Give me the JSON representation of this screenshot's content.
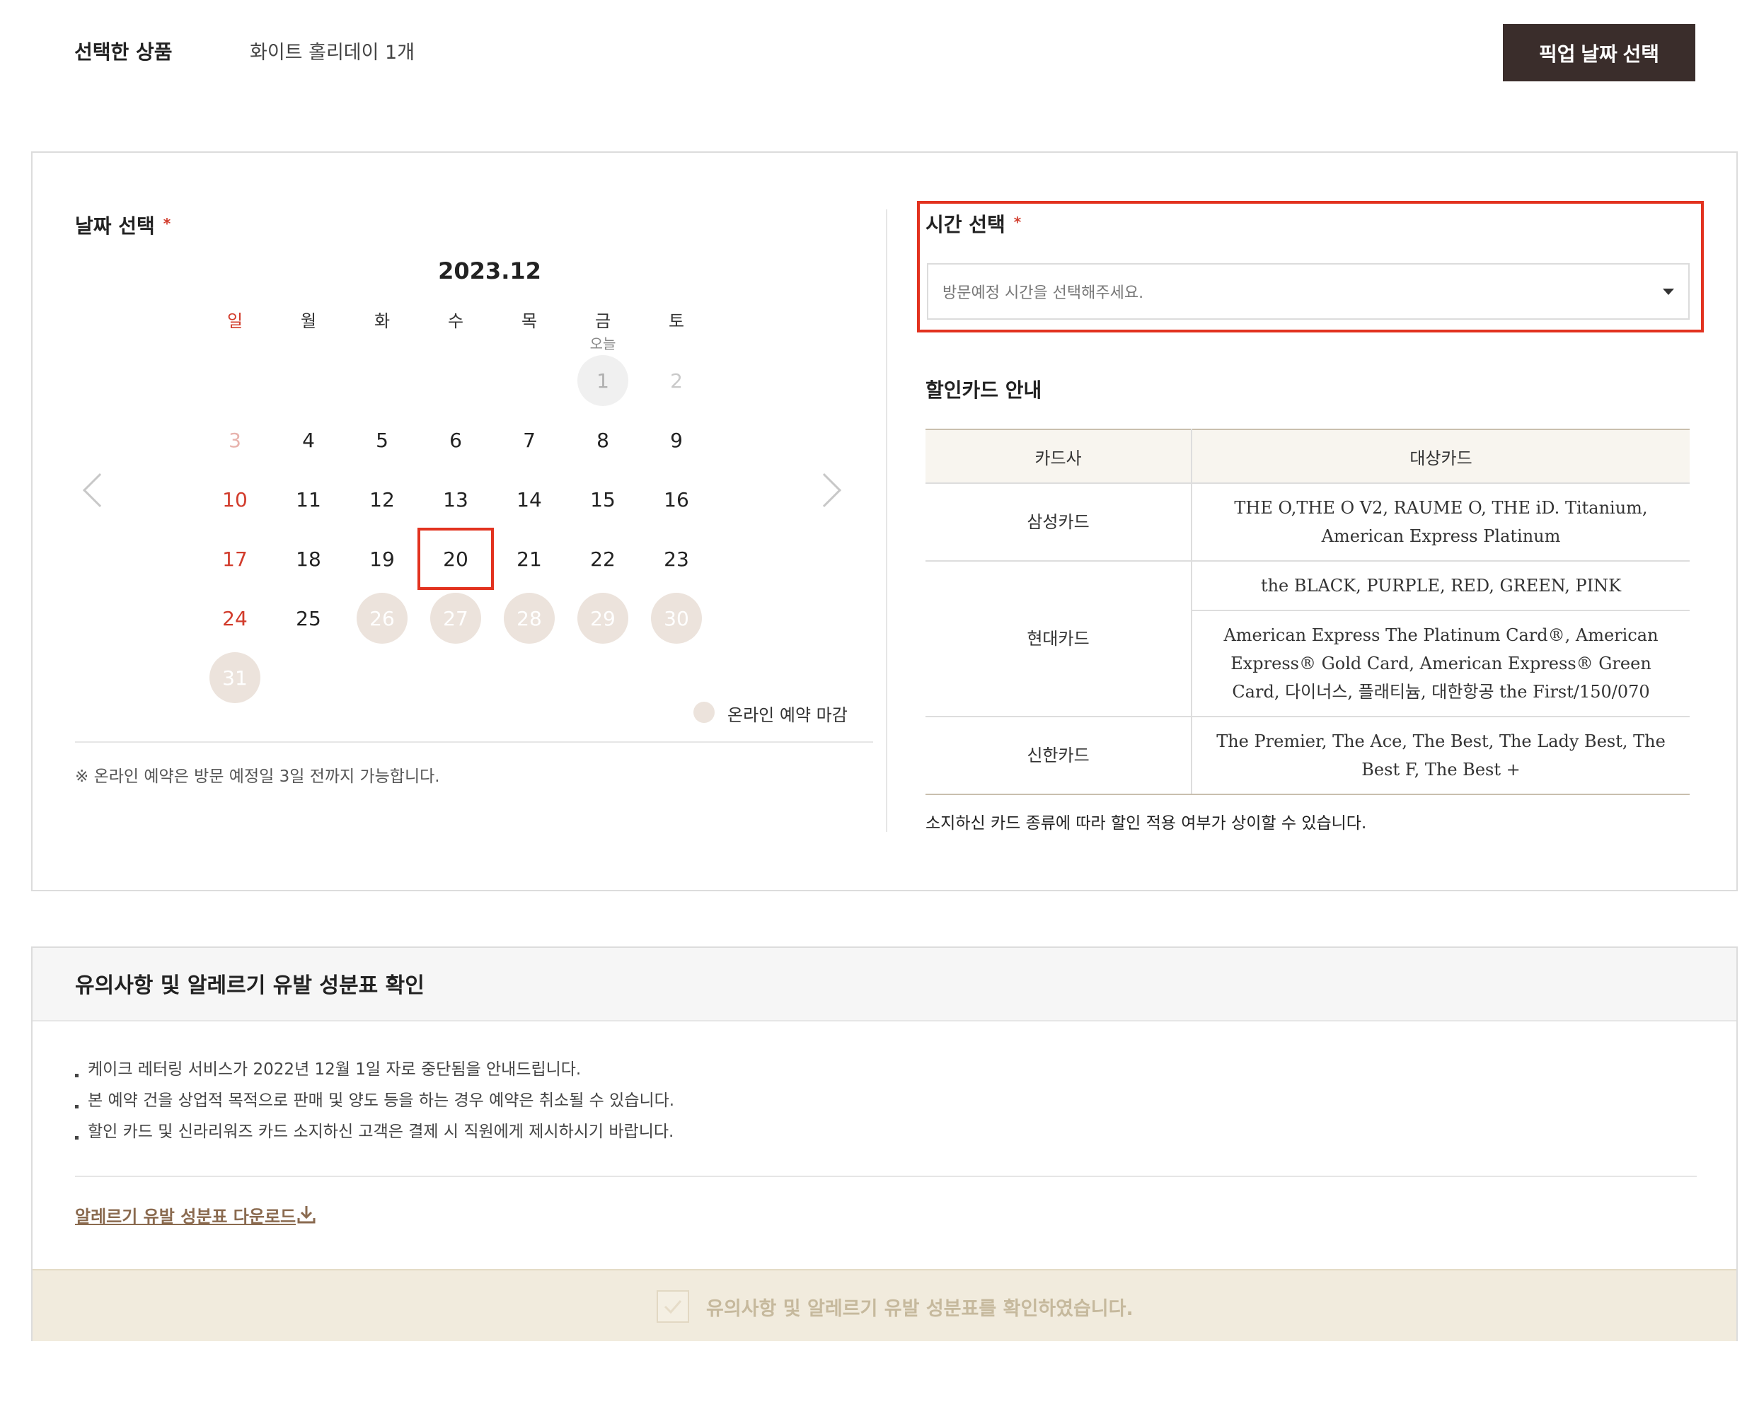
{
  "header": {
    "selected_label": "선택한 상품",
    "selected_value": "화이트 홀리데이 1개",
    "pickup_button": "픽업 날짜 선택"
  },
  "calendar": {
    "section_title": "날짜 선택",
    "required_mark": "*",
    "month": "2023.12",
    "weekdays": [
      "일",
      "월",
      "화",
      "수",
      "목",
      "금",
      "토"
    ],
    "today_label": "오늘",
    "days": {
      "d1": "1",
      "d2": "2",
      "d3": "3",
      "d4": "4",
      "d5": "5",
      "d6": "6",
      "d7": "7",
      "d8": "8",
      "d9": "9",
      "d10": "10",
      "d11": "11",
      "d12": "12",
      "d13": "13",
      "d14": "14",
      "d15": "15",
      "d16": "16",
      "d17": "17",
      "d18": "18",
      "d19": "19",
      "d20": "20",
      "d21": "21",
      "d22": "22",
      "d23": "23",
      "d24": "24",
      "d25": "25",
      "d26": "26",
      "d27": "27",
      "d28": "28",
      "d29": "29",
      "d30": "30",
      "d31": "31"
    },
    "selected_day": "20",
    "legend": "온라인 예약 마감",
    "note": "※ 온라인 예약은 방문 예정일 3일 전까지 가능합니다."
  },
  "time": {
    "section_title": "시간 선택",
    "required_mark": "*",
    "placeholder": "방문예정 시간을 선택해주세요."
  },
  "discount": {
    "section_title": "할인카드 안내",
    "headers": [
      "카드사",
      "대상카드"
    ],
    "rows": {
      "samsung": {
        "company": "삼성카드",
        "cards": "THE O,THE O V2, RAUME O, THE iD. Titanium, American Express Platinum"
      },
      "hyundai": {
        "company": "현대카드",
        "cards_a": "the BLACK, PURPLE, RED, GREEN, PINK",
        "cards_b": "American Express The Platinum Card®, American Express® Gold Card, American Express® Green Card, 다이너스, 플래티늄, 대한항공 the First/150/070"
      },
      "shinhan": {
        "company": "신한카드",
        "cards": "The Premier, The Ace, The Best, The Lady Best, The Best F, The Best +"
      }
    },
    "note": "소지하신 카드 종류에 따라 할인 적용 여부가 상이할 수 있습니다."
  },
  "notice": {
    "title": "유의사항 및 알레르기 유발 성분표 확인",
    "items": [
      "케이크 레터링 서비스가 2022년 12월 1일 자로 중단됨을 안내드립니다.",
      "본 예약 건을 상업적 목적으로 판매 및 양도 등을 하는 경우 예약은 취소될 수 있습니다.",
      "할인 카드 및 신라리워즈 카드 소지하신 고객은 결제 시 직원에게 제시하시기 바랍니다."
    ],
    "download_link": "알레르기 유발 성분표 다운로드",
    "confirm_label": "유의사항 및 알레르기 유발 성분표를 확인하였습니다."
  },
  "colors": {
    "accent_red": "#e2321f",
    "button_dark": "#3a2d2b",
    "closed_day": "#ece3dc",
    "link_brown": "#8a6a4f"
  }
}
